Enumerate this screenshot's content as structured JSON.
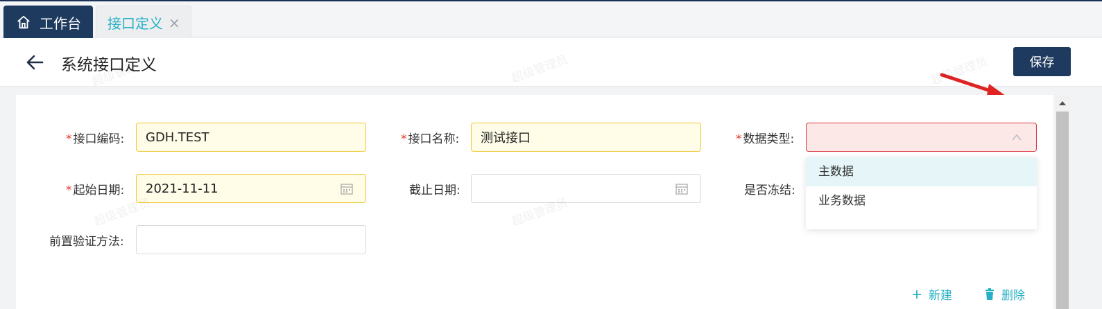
{
  "tabs": {
    "home_label": "工作台",
    "active_label": "接口定义",
    "close_glyph": "×"
  },
  "header": {
    "title": "系统接口定义",
    "save_label": "保存"
  },
  "form": {
    "code": {
      "required": "*",
      "label": "接口编码",
      "colon": ":",
      "value": "GDH.TEST"
    },
    "name": {
      "required": "*",
      "label": "接口名称",
      "colon": ":",
      "value": "测试接口"
    },
    "data_type": {
      "required": "*",
      "label": "数据类型",
      "colon": ":",
      "value": ""
    },
    "start_date": {
      "required": "*",
      "label": "起始日期",
      "colon": ":",
      "value": "2021-11-11"
    },
    "end_date": {
      "label": "截止日期",
      "colon": ":",
      "value": ""
    },
    "frozen": {
      "label": "是否冻结",
      "colon": ":"
    },
    "pre_validate": {
      "label": "前置验证方法",
      "colon": ":",
      "value": ""
    }
  },
  "dropdown": {
    "options": [
      "主数据",
      "业务数据"
    ]
  },
  "actions": {
    "new_label": "新建",
    "delete_label": "删除"
  },
  "watermark_text": "超级管理员",
  "colors": {
    "primary": "#1e3a5f",
    "accent": "#27b0c5",
    "required": "#e5302a",
    "annotation_arrow": "#e02424"
  }
}
